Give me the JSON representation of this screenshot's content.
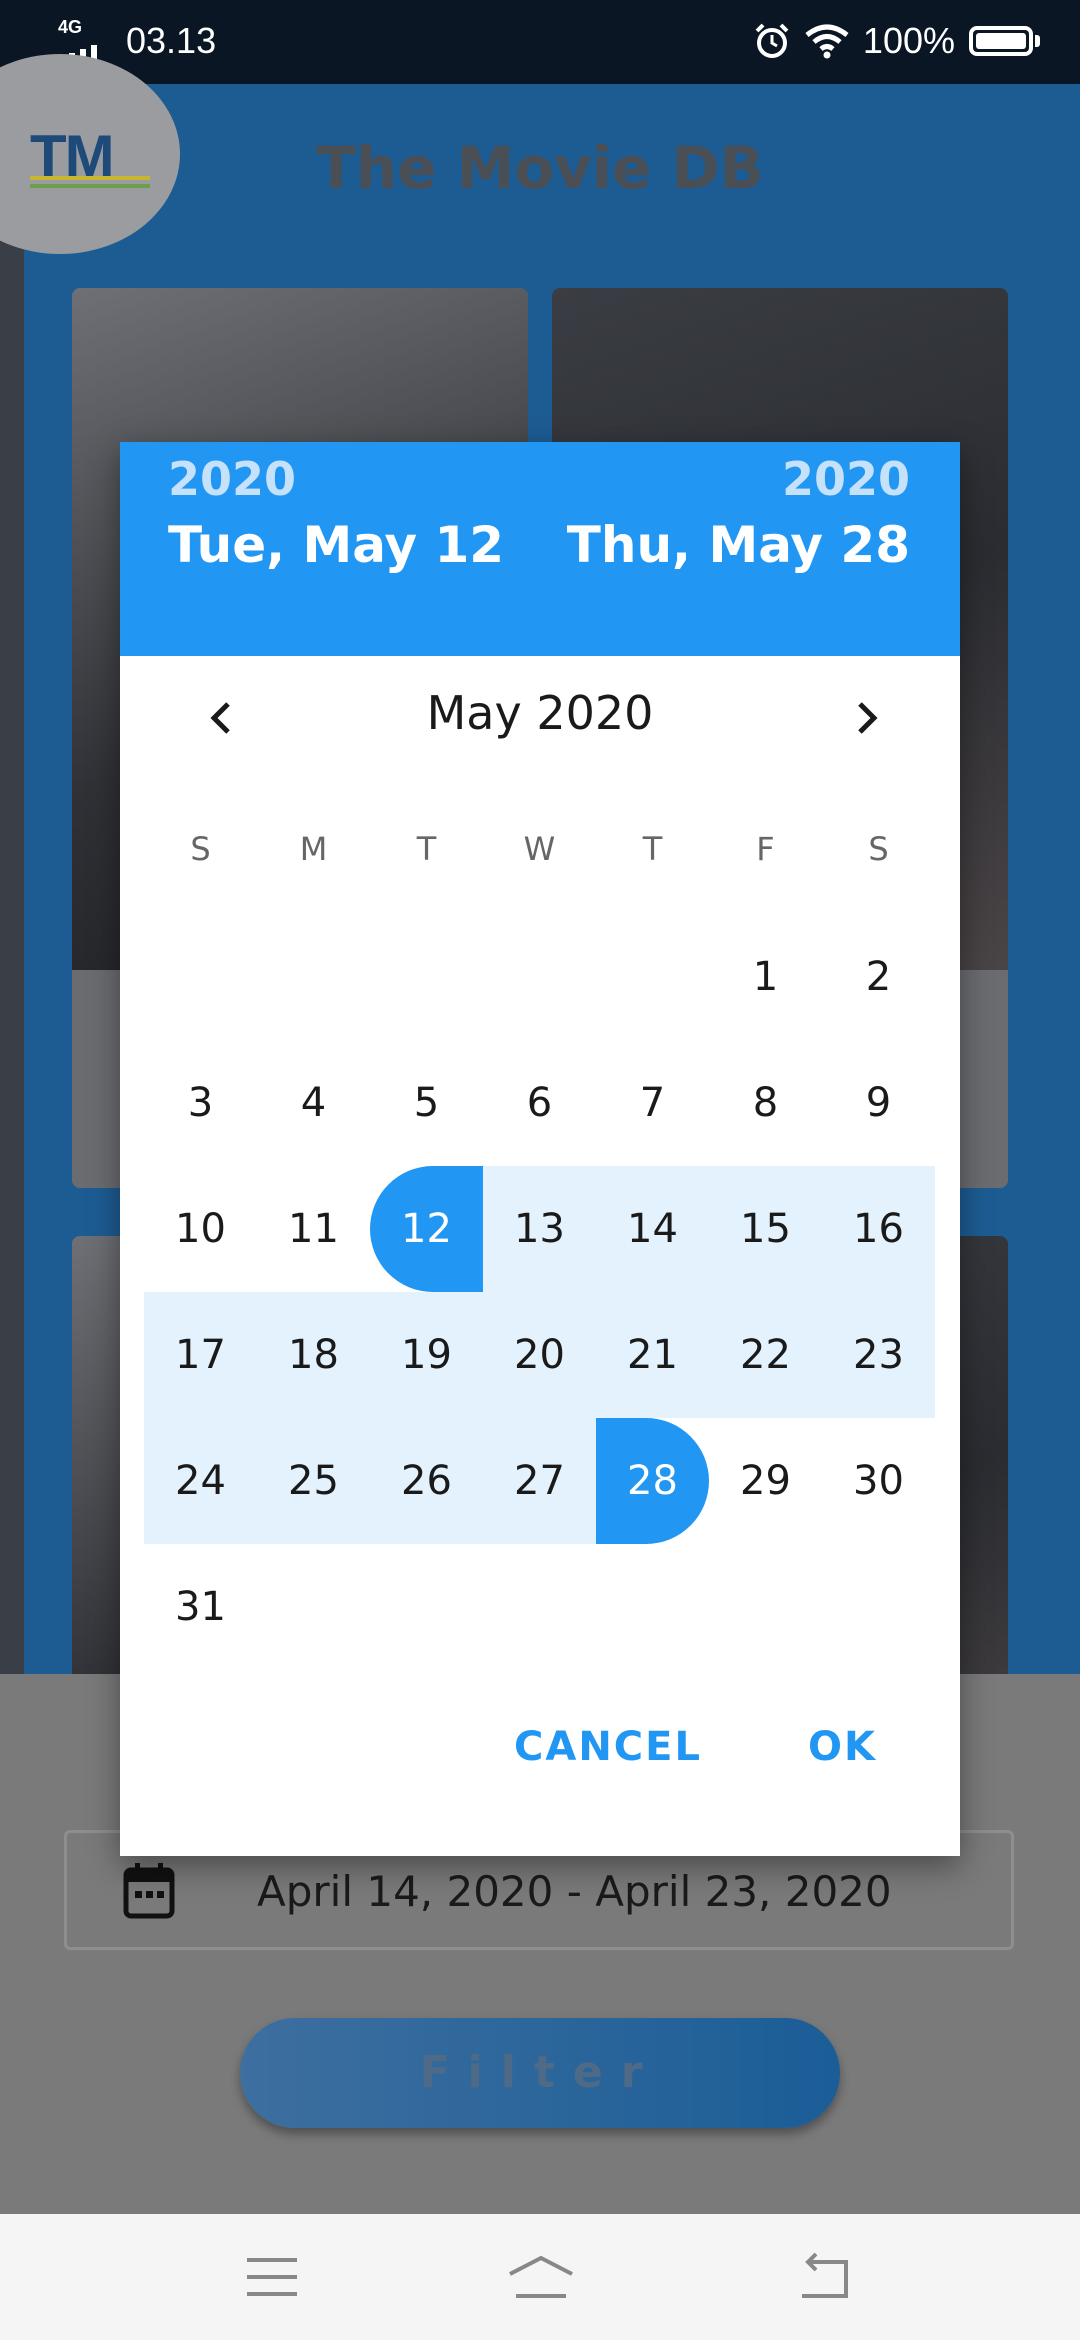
{
  "status_bar": {
    "network": "4G",
    "time": "03.13",
    "battery": "100%",
    "icons": [
      "signal-icon",
      "alarm-icon",
      "wifi-icon",
      "battery-icon"
    ]
  },
  "app": {
    "logo": "TM",
    "title": "The Movie DB"
  },
  "filter": {
    "date_range": "April 14, 2020 - April 23, 2020",
    "button_label": "Filter"
  },
  "dialog": {
    "start_year": "2020",
    "start_date": "Tue, May 12",
    "end_year": "2020",
    "end_date": "Thu, May 28",
    "month_title": "May 2020",
    "weekdays": [
      "S",
      "M",
      "T",
      "W",
      "T",
      "F",
      "S"
    ],
    "first_weekday_index": 5,
    "days_in_month": 31,
    "range_start_day": 12,
    "range_end_day": 28,
    "cancel_label": "CANCEL",
    "ok_label": "OK"
  },
  "colors": {
    "accent": "#2196f3",
    "range_fill": "#e3f2fd"
  }
}
